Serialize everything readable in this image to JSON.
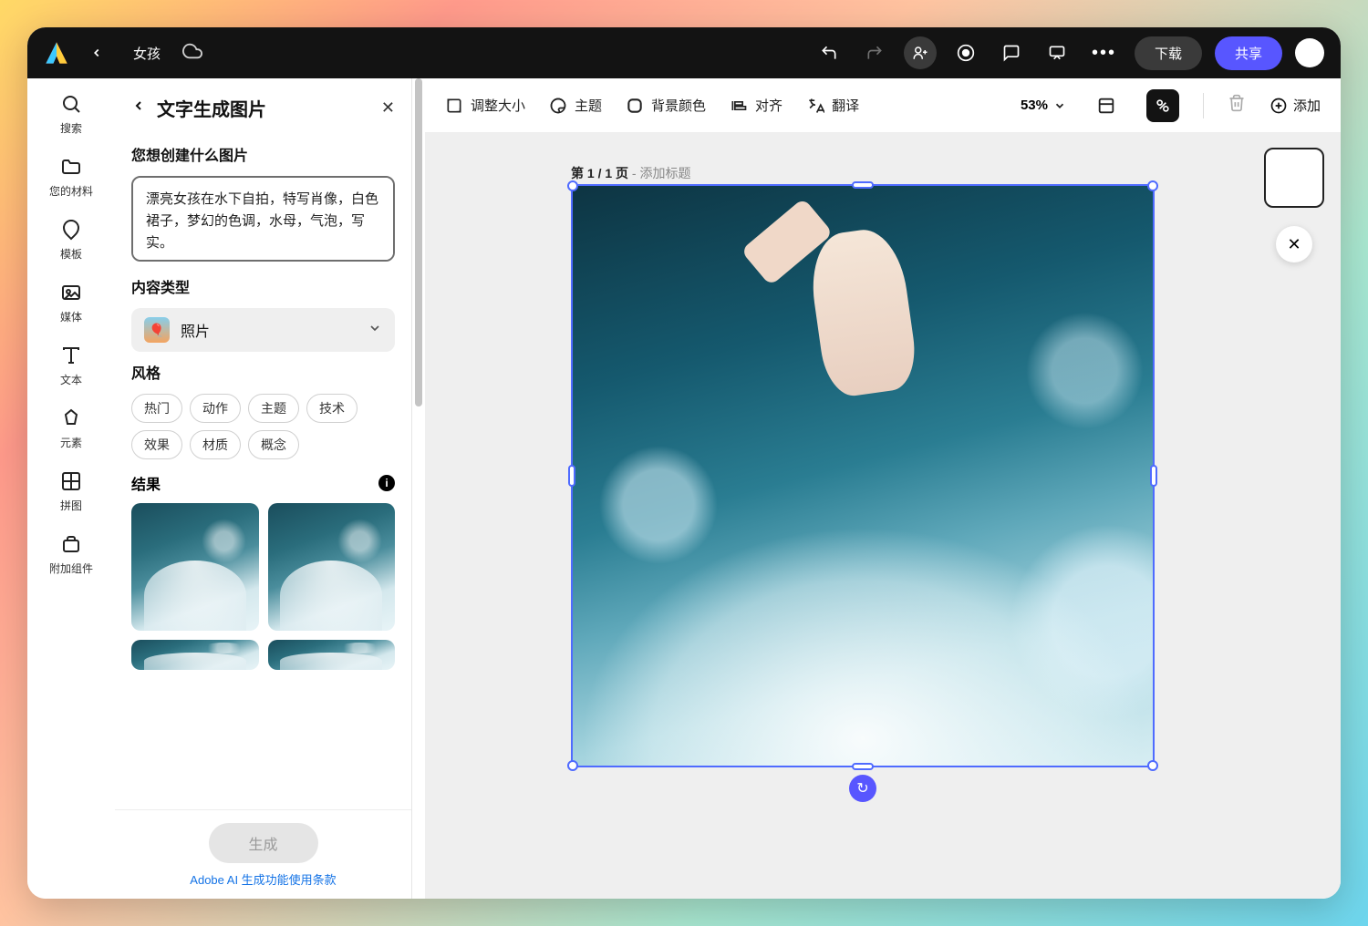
{
  "header": {
    "title": "女孩",
    "download": "下载",
    "share": "共享"
  },
  "rail": {
    "search": "搜索",
    "your_stuff": "您的材料",
    "templates": "模板",
    "media": "媒体",
    "text": "文本",
    "elements": "元素",
    "grids": "拼图",
    "addons": "附加组件"
  },
  "panel": {
    "title": "文字生成图片",
    "prompt_label": "您想创建什么图片",
    "prompt_value": "漂亮女孩在水下自拍，特写肖像，白色裙子，梦幻的色调，水母，气泡，写实。",
    "content_type_label": "内容类型",
    "content_type_value": "照片",
    "style_label": "风格",
    "style_chips": [
      "热门",
      "动作",
      "主题",
      "技术",
      "效果",
      "材质",
      "概念"
    ],
    "results_label": "结果",
    "generate": "生成",
    "terms": "Adobe AI 生成功能使用条款"
  },
  "toolbar": {
    "resize": "调整大小",
    "theme": "主题",
    "bgcolor": "背景颜色",
    "align": "对齐",
    "translate": "翻译",
    "zoom": "53%",
    "add": "添加"
  },
  "canvas": {
    "page_prefix": "第 1 / 1 页",
    "page_suffix": " - 添加标题"
  }
}
